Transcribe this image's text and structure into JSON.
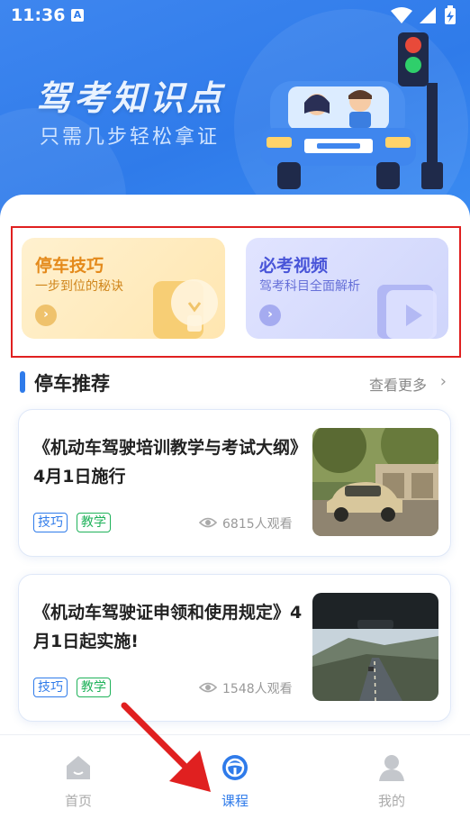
{
  "status_bar": {
    "time": "11:36",
    "notification_icon_letter": "A",
    "icons": [
      "wifi-icon",
      "signal-icon",
      "battery-charging-icon"
    ]
  },
  "hero": {
    "title": "驾考知识点",
    "subtitle": "只需几步轻松拿证"
  },
  "features": [
    {
      "title": "停车技巧",
      "subtitle": "一步到位的秘诀",
      "icon": "lightbulb-icon"
    },
    {
      "title": "必考视频",
      "subtitle": "驾考科目全面解析",
      "icon": "video-play-icon"
    }
  ],
  "section": {
    "title": "停车推荐",
    "more_label": "查看更多"
  },
  "articles": [
    {
      "title": "《机动车驾驶培训教学与考试大纲》4月1日施行",
      "tags": [
        "技巧",
        "教学"
      ],
      "views": "6815人观看",
      "thumb": "vintage-car-photo"
    },
    {
      "title": "《机动车驾驶证申领和使用规定》4月1日起实施!",
      "tags": [
        "技巧",
        "教学"
      ],
      "views": "1548人观看",
      "thumb": "road-through-windshield-photo"
    }
  ],
  "tabbar": {
    "items": [
      {
        "label": "首页",
        "icon": "home-icon",
        "active": false
      },
      {
        "label": "课程",
        "icon": "steering-wheel-icon",
        "active": true
      },
      {
        "label": "我的",
        "icon": "user-icon",
        "active": false
      }
    ]
  },
  "colors": {
    "primary": "#2f7bea",
    "tag_green": "#1fb25a",
    "highlight_red": "#e02020"
  }
}
